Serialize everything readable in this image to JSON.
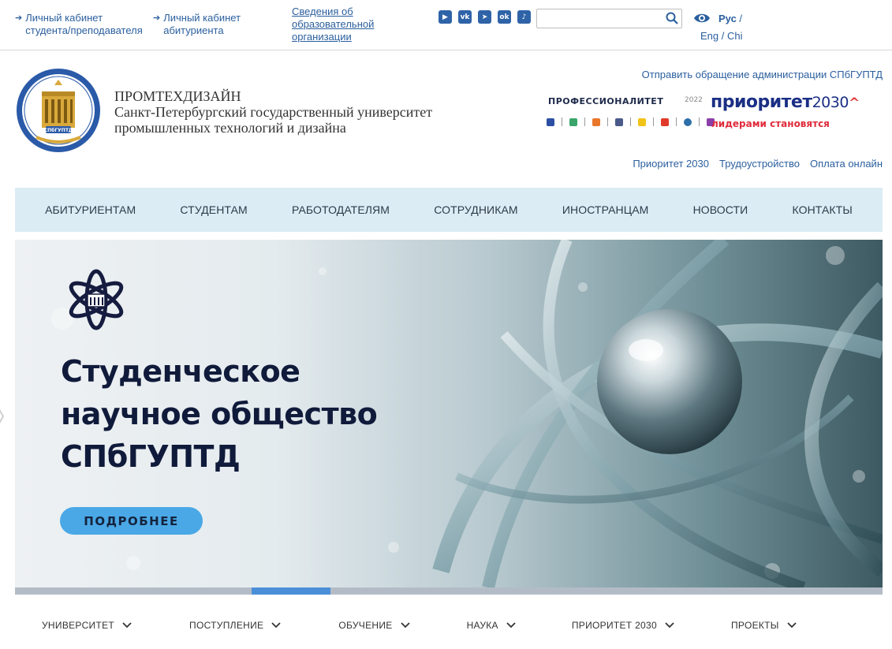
{
  "topbar": {
    "student_cabinet": "Личный кабинет\nстудента/преподавателя",
    "applicant_cabinet": "Личный кабинет\nабитуриента",
    "org_info": "Сведения об\nобразовательной\nорганизации",
    "socials": [
      {
        "icon": "youtube-icon",
        "glyph": "▶"
      },
      {
        "icon": "vk-icon",
        "glyph": "vk"
      },
      {
        "icon": "telegram-icon",
        "glyph": "➤"
      },
      {
        "icon": "odnoklassniki-icon",
        "glyph": "ok"
      },
      {
        "icon": "tiktok-icon",
        "glyph": "♪"
      }
    ],
    "search_value": "",
    "lang_active": "Рус",
    "lang_sep": " /",
    "lang_other": "Eng / Chi"
  },
  "header": {
    "brand_name": "ПРОМТЕХДИЗАЙН",
    "brand_full": "Санкт-Петербургский государственный университет\nпромышленных технологий и дизайна",
    "appeal_link": "Отправить обращение администрации СПбГУПТД",
    "prof_label": "ПРОФЕССИОНАЛИТЕТ",
    "prof_year": "2022",
    "priority_word": "приоритет",
    "priority_num": "2030",
    "priority_caret": "^",
    "priority_slogan": "лидерами становятся",
    "links": [
      "Приоритет 2030",
      "Трудоустройство",
      "Оплата онлайн"
    ]
  },
  "mainnav": [
    "АБИТУРИЕНТАМ",
    "СТУДЕНТАМ",
    "РАБОТОДАТЕЛЯМ",
    "СОТРУДНИКАМ",
    "ИНОСТРАНЦАМ",
    "НОВОСТИ",
    "КОНТАКТЫ"
  ],
  "hero": {
    "title": "Студенческое\nнаучное общество\nСПбГУПТД",
    "button": "ПОДРОБНЕЕ",
    "slide_index": 4,
    "slide_count": 11
  },
  "subnav": [
    "УНИВЕРСИТЕТ",
    "ПОСТУПЛЕНИЕ",
    "ОБУЧЕНИЕ",
    "НАУКА",
    "ПРИОРИТЕТ 2030",
    "ПРОЕКТЫ"
  ],
  "colors": {
    "link": "#2b5f9e",
    "nav_bg": "#dcecf5",
    "button": "#4aa8e6",
    "slider_active": "#4a8fd8"
  }
}
